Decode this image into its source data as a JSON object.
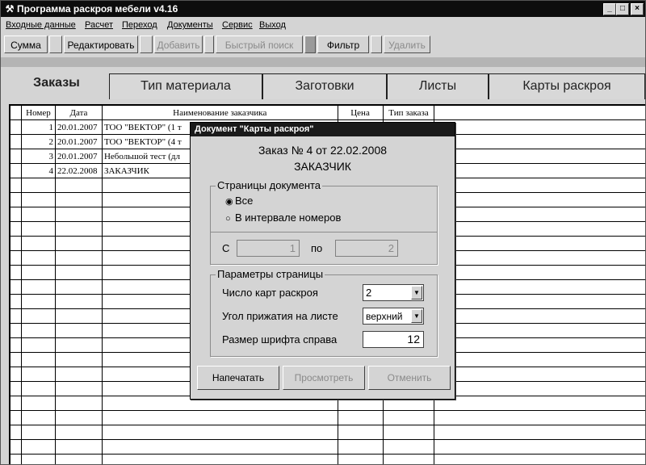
{
  "window": {
    "title": "Программа раскроя мебели v4.16",
    "minimize": "_",
    "maximize": "□",
    "close": "×"
  },
  "menu": [
    "Входные данные",
    "Расчет",
    "Переход",
    "Документы",
    "Сервис",
    "Выход"
  ],
  "toolbar": {
    "summa": "Сумма",
    "edit": "Редактировать",
    "add": "Добавить",
    "quick_search": "Быстрый поиск",
    "filter": "Фильтр",
    "delete": "Удалить"
  },
  "tabs": [
    "Заказы",
    "Тип материала",
    "Заготовки",
    "Листы",
    "Карты раскроя"
  ],
  "table": {
    "headers": [
      "Номер",
      "Дата",
      "Наименование заказчика",
      "Цена",
      "Тип заказа"
    ],
    "rows": [
      [
        "1",
        "20.01.2007",
        "ТОО \"ВЕКТОР\" (1 т",
        "",
        ""
      ],
      [
        "2",
        "20.01.2007",
        "ТОО \"ВЕКТОР\" (4 т",
        "",
        ""
      ],
      [
        "3",
        "20.01.2007",
        "Небольшой тест (дл",
        "",
        ""
      ],
      [
        "4",
        "22.02.2008",
        "ЗАКАЗЧИК",
        "",
        ""
      ]
    ]
  },
  "dialog": {
    "title": "Документ \"Карты раскроя\"",
    "order_line": "Заказ № 4 от 22.02.2008",
    "customer": "ЗАКАЗЧИК",
    "pages_group": "Страницы документа",
    "radio_all": "Все",
    "radio_range": "В интервале номеров",
    "from_label": "С",
    "from_value": "1",
    "to_label": "по",
    "to_value": "2",
    "params_group": "Параметры страницы",
    "cards_label": "Число карт раскроя",
    "cards_value": "2",
    "align_label": "Угол прижатия на листе",
    "align_value": "верхний",
    "font_label": "Размер шрифта справа",
    "font_value": "12",
    "print_btn": "Напечатать",
    "preview_btn": "Просмотреть",
    "cancel_btn": "Отменить"
  }
}
